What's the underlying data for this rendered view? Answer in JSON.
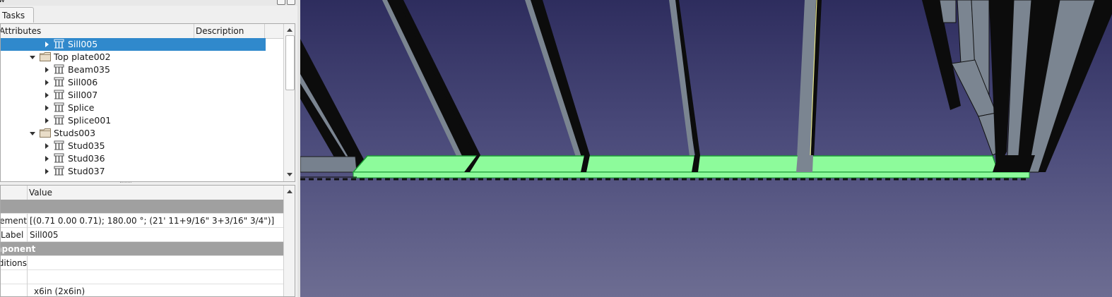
{
  "window": {
    "title_fragment": "w"
  },
  "tabs": {
    "tasks": "Tasks"
  },
  "tree": {
    "columns": {
      "attributes": "Attributes",
      "description": "Description"
    },
    "rows": [
      {
        "label": "Sill005",
        "kind": "part",
        "depth": 2,
        "expander": "right",
        "selected": true
      },
      {
        "label": "Top plate002",
        "kind": "folder",
        "depth": 1,
        "expander": "down",
        "selected": false
      },
      {
        "label": "Beam035",
        "kind": "part",
        "depth": 2,
        "expander": "right",
        "selected": false
      },
      {
        "label": "Sill006",
        "kind": "part",
        "depth": 2,
        "expander": "right",
        "selected": false
      },
      {
        "label": "Sill007",
        "kind": "part",
        "depth": 2,
        "expander": "right",
        "selected": false
      },
      {
        "label": "Splice",
        "kind": "part",
        "depth": 2,
        "expander": "right",
        "selected": false
      },
      {
        "label": "Splice001",
        "kind": "part",
        "depth": 2,
        "expander": "right",
        "selected": false
      },
      {
        "label": "Studs003",
        "kind": "folder",
        "depth": 1,
        "expander": "down",
        "selected": false
      },
      {
        "label": "Stud035",
        "kind": "part",
        "depth": 2,
        "expander": "right",
        "selected": false
      },
      {
        "label": "Stud036",
        "kind": "part",
        "depth": 2,
        "expander": "right",
        "selected": false
      },
      {
        "label": "Stud037",
        "kind": "part",
        "depth": 2,
        "expander": "right",
        "selected": false
      }
    ]
  },
  "properties": {
    "columns": {
      "property": "",
      "value": "Value"
    },
    "rows": [
      {
        "type": "group",
        "key": "",
        "value": ""
      },
      {
        "type": "prop",
        "key": "Placement",
        "value": "[(0.71 0.00 0.71); 180.00 °; (21' 11+9/16\"  3+3/16\"  3/4\")]"
      },
      {
        "type": "prop",
        "key": "Label",
        "value": "Sill005"
      },
      {
        "type": "group",
        "key": "Component",
        "value": ""
      },
      {
        "type": "prop",
        "key": "Additions",
        "value": ""
      },
      {
        "type": "prop",
        "key": "",
        "value": ""
      },
      {
        "type": "prop",
        "key": "",
        "value": "x6in (2x6in)"
      }
    ]
  },
  "viewport": {
    "background_top": "#2e2d5e",
    "background_bottom": "#6d6d92",
    "highlight_color": "#8dfb9b",
    "member_face_color": "#7b8591",
    "member_dark_color": "#0c0c0c",
    "edge_highlight_color": "#e7e58a"
  }
}
